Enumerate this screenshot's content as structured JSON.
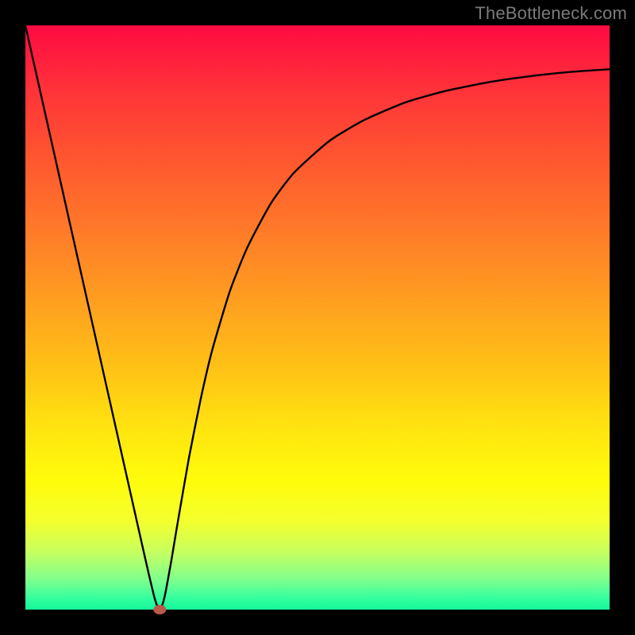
{
  "watermark": "TheBottleneck.com",
  "chart_data": {
    "type": "line",
    "title": "",
    "xlabel": "",
    "ylabel": "",
    "xlim": [
      0,
      100
    ],
    "ylim": [
      0,
      100
    ],
    "grid": false,
    "legend": false,
    "series": [
      {
        "name": "bottleneck-curve",
        "x": [
          0,
          4,
          8,
          12,
          16,
          18,
          20,
          21,
          22,
          22.5,
          23,
          23.5,
          24,
          25,
          26,
          28,
          30,
          32,
          35,
          38,
          42,
          46,
          52,
          58,
          65,
          72,
          80,
          88,
          94,
          100
        ],
        "y": [
          100,
          82.2,
          64.4,
          46.6,
          28.8,
          19.9,
          11.0,
          6.6,
          2.4,
          0.8,
          0.0,
          1.0,
          3.0,
          8.5,
          14.5,
          26.0,
          36.0,
          44.5,
          54.5,
          62.0,
          69.5,
          74.8,
          80.2,
          83.8,
          86.8,
          88.8,
          90.4,
          91.5,
          92.1,
          92.5
        ]
      }
    ],
    "marker": {
      "name": "optimal-point",
      "x": 23,
      "y": 0,
      "color": "#b85a4a",
      "rx": 8,
      "ry": 6
    },
    "background_gradient": {
      "top": "#ff0a42",
      "mid": "#ffe70f",
      "bottom": "#14f79a"
    }
  }
}
